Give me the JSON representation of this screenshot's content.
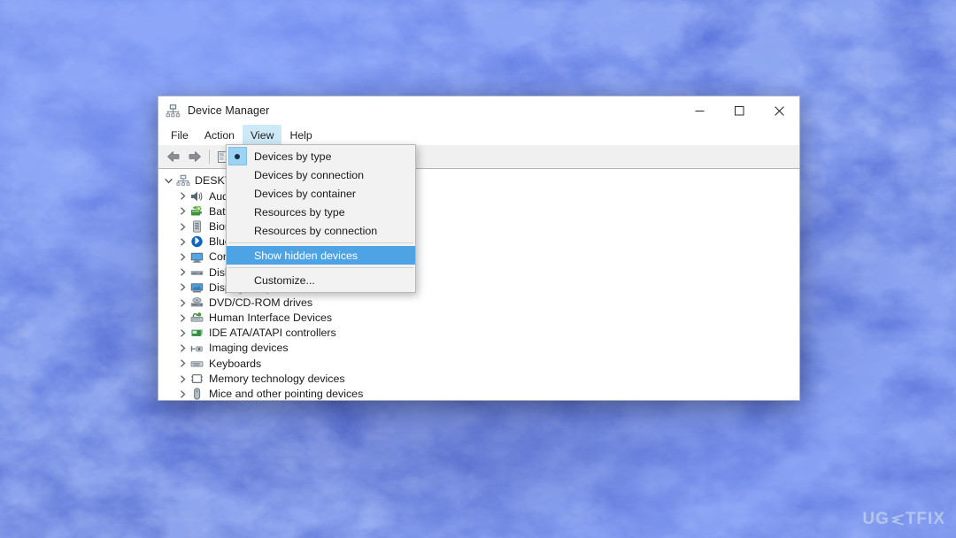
{
  "desktop": {
    "wallpaper_name": "blue-nebula-texture",
    "base_color": "#2442cf",
    "light_color": "#7d97f2",
    "dark_color": "#16249b"
  },
  "window": {
    "title": "Device Manager",
    "icon": "device-manager-icon",
    "controls": {
      "minimize": "─",
      "maximize": "□",
      "close": "✕"
    },
    "menubar": [
      {
        "label": "File",
        "active": false
      },
      {
        "label": "Action",
        "active": false
      },
      {
        "label": "View",
        "active": true
      },
      {
        "label": "Help",
        "active": false
      }
    ],
    "toolbar": [
      {
        "icon": "back-arrow-icon",
        "name": "back-button"
      },
      {
        "icon": "forward-arrow-icon",
        "name": "forward-button"
      },
      {
        "icon": "separator",
        "name": "toolbar-separator"
      },
      {
        "icon": "properties-icon",
        "name": "properties-button"
      },
      {
        "icon": "separator",
        "name": "toolbar-separator-2"
      }
    ],
    "tree": [
      {
        "label": "DESKTOP",
        "icon": "computer-node-icon",
        "level": "root",
        "expanded": true
      },
      {
        "label": "Audio inputs and outputs",
        "icon": "speaker-icon",
        "level": "child",
        "expanded": false
      },
      {
        "label": "Batteries",
        "icon": "battery-icon",
        "level": "child",
        "expanded": false
      },
      {
        "label": "Biometric devices",
        "icon": "fingerprint-icon",
        "level": "child",
        "expanded": false
      },
      {
        "label": "Bluetooth",
        "icon": "bluetooth-icon",
        "level": "child",
        "expanded": false
      },
      {
        "label": "Computer",
        "icon": "monitor-icon",
        "level": "child",
        "expanded": false
      },
      {
        "label": "Disk drives",
        "icon": "disk-drive-icon",
        "level": "child",
        "expanded": false
      },
      {
        "label": "Display adapters",
        "icon": "display-adapter-icon",
        "level": "child",
        "expanded": false
      },
      {
        "label": "DVD/CD-ROM drives",
        "icon": "dvd-drive-icon",
        "level": "child",
        "expanded": false
      },
      {
        "label": "Human Interface Devices",
        "icon": "hid-icon",
        "level": "child",
        "expanded": false
      },
      {
        "label": "IDE ATA/ATAPI controllers",
        "icon": "ide-controller-icon",
        "level": "child",
        "expanded": false
      },
      {
        "label": "Imaging devices",
        "icon": "imaging-device-icon",
        "level": "child",
        "expanded": false
      },
      {
        "label": "Keyboards",
        "icon": "keyboard-icon",
        "level": "child",
        "expanded": false
      },
      {
        "label": "Memory technology devices",
        "icon": "memory-icon",
        "level": "child",
        "expanded": false
      },
      {
        "label": "Mice and other pointing devices",
        "icon": "mouse-icon",
        "level": "child",
        "expanded": false
      }
    ]
  },
  "view_menu": {
    "items": [
      {
        "label": "Devices by type",
        "radio_selected": true,
        "highlight": false
      },
      {
        "label": "Devices by connection",
        "radio_selected": false,
        "highlight": false
      },
      {
        "label": "Devices by container",
        "radio_selected": false,
        "highlight": false
      },
      {
        "label": "Resources by type",
        "radio_selected": false,
        "highlight": false
      },
      {
        "label": "Resources by connection",
        "radio_selected": false,
        "highlight": false
      },
      {
        "label": "Show hidden devices",
        "radio_selected": false,
        "highlight": true
      },
      {
        "label": "Customize...",
        "radio_selected": false,
        "highlight": false
      }
    ],
    "highlight_color": "#4da3e3"
  },
  "watermark": {
    "part1": "UG",
    "part2": "TFIX",
    "full": "UGETFIX"
  }
}
